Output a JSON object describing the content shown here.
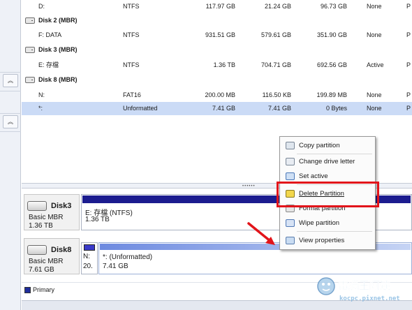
{
  "partition_list": {
    "rows": [
      {
        "kind": "partition",
        "name": "D:",
        "fs": "NTFS",
        "capacity": "117.97 GB",
        "used": "21.24 GB",
        "unused": "96.73 GB",
        "status": "None",
        "type": "P"
      },
      {
        "kind": "disk",
        "name": "Disk 2 (MBR)"
      },
      {
        "kind": "partition",
        "name": "F: DATA",
        "fs": "NTFS",
        "capacity": "931.51 GB",
        "used": "579.61 GB",
        "unused": "351.90 GB",
        "status": "None",
        "type": "P"
      },
      {
        "kind": "disk",
        "name": "Disk 3 (MBR)"
      },
      {
        "kind": "partition",
        "name": "E: 存檔",
        "fs": "NTFS",
        "capacity": "1.36 TB",
        "used": "704.71 GB",
        "unused": "692.56 GB",
        "status": "Active",
        "type": "P"
      },
      {
        "kind": "disk",
        "name": "Disk 8 (MBR)"
      },
      {
        "kind": "partition",
        "name": "N:",
        "fs": "FAT16",
        "capacity": "200.00 MB",
        "used": "116.50 KB",
        "unused": "199.89 MB",
        "status": "None",
        "type": "P"
      },
      {
        "kind": "partition",
        "name": "*:",
        "fs": "Unformatted",
        "capacity": "7.41 GB",
        "used": "7.41 GB",
        "unused": "0 Bytes",
        "status": "None",
        "type": "P",
        "selected": true
      }
    ]
  },
  "left_panel": {
    "collapse_icon_1": "chevron-double-up-icon",
    "collapse_icon_2": "chevron-double-up-icon"
  },
  "disk_map": {
    "disk3": {
      "name": "Disk3",
      "type": "Basic MBR",
      "size": "1.36 TB",
      "partition_label": "E: 存檔 (NTFS)",
      "partition_size": "1.36 TB"
    },
    "disk8": {
      "name": "Disk8",
      "type": "Basic MBR",
      "size": "7.61 GB",
      "small_label_1": "N:",
      "small_label_2": "20.",
      "partition_label": "*: (Unformatted)",
      "partition_size": "7.41 GB"
    }
  },
  "legend": {
    "primary_label": "Primary",
    "primary_color": "#1f2d9b"
  },
  "context_menu": {
    "items": [
      {
        "label": "Copy partition",
        "icon": "copy-icon"
      },
      {
        "label": "Change drive letter",
        "icon": "drive-letter-icon"
      },
      {
        "label": "Set active",
        "icon": "set-active-icon"
      },
      {
        "label": "Delete Partition",
        "icon": "delete-partition-icon",
        "highlighted": true
      },
      {
        "label": "Format partition",
        "icon": "format-icon"
      },
      {
        "label": "Wipe partition",
        "icon": "wipe-icon"
      },
      {
        "label": "View properties",
        "icon": "properties-icon"
      }
    ]
  },
  "annotation": {
    "highlight_color": "#e2141a"
  },
  "watermark": {
    "line1": "電腦王阿達",
    "line2": "kocpc.pixnet.net"
  }
}
